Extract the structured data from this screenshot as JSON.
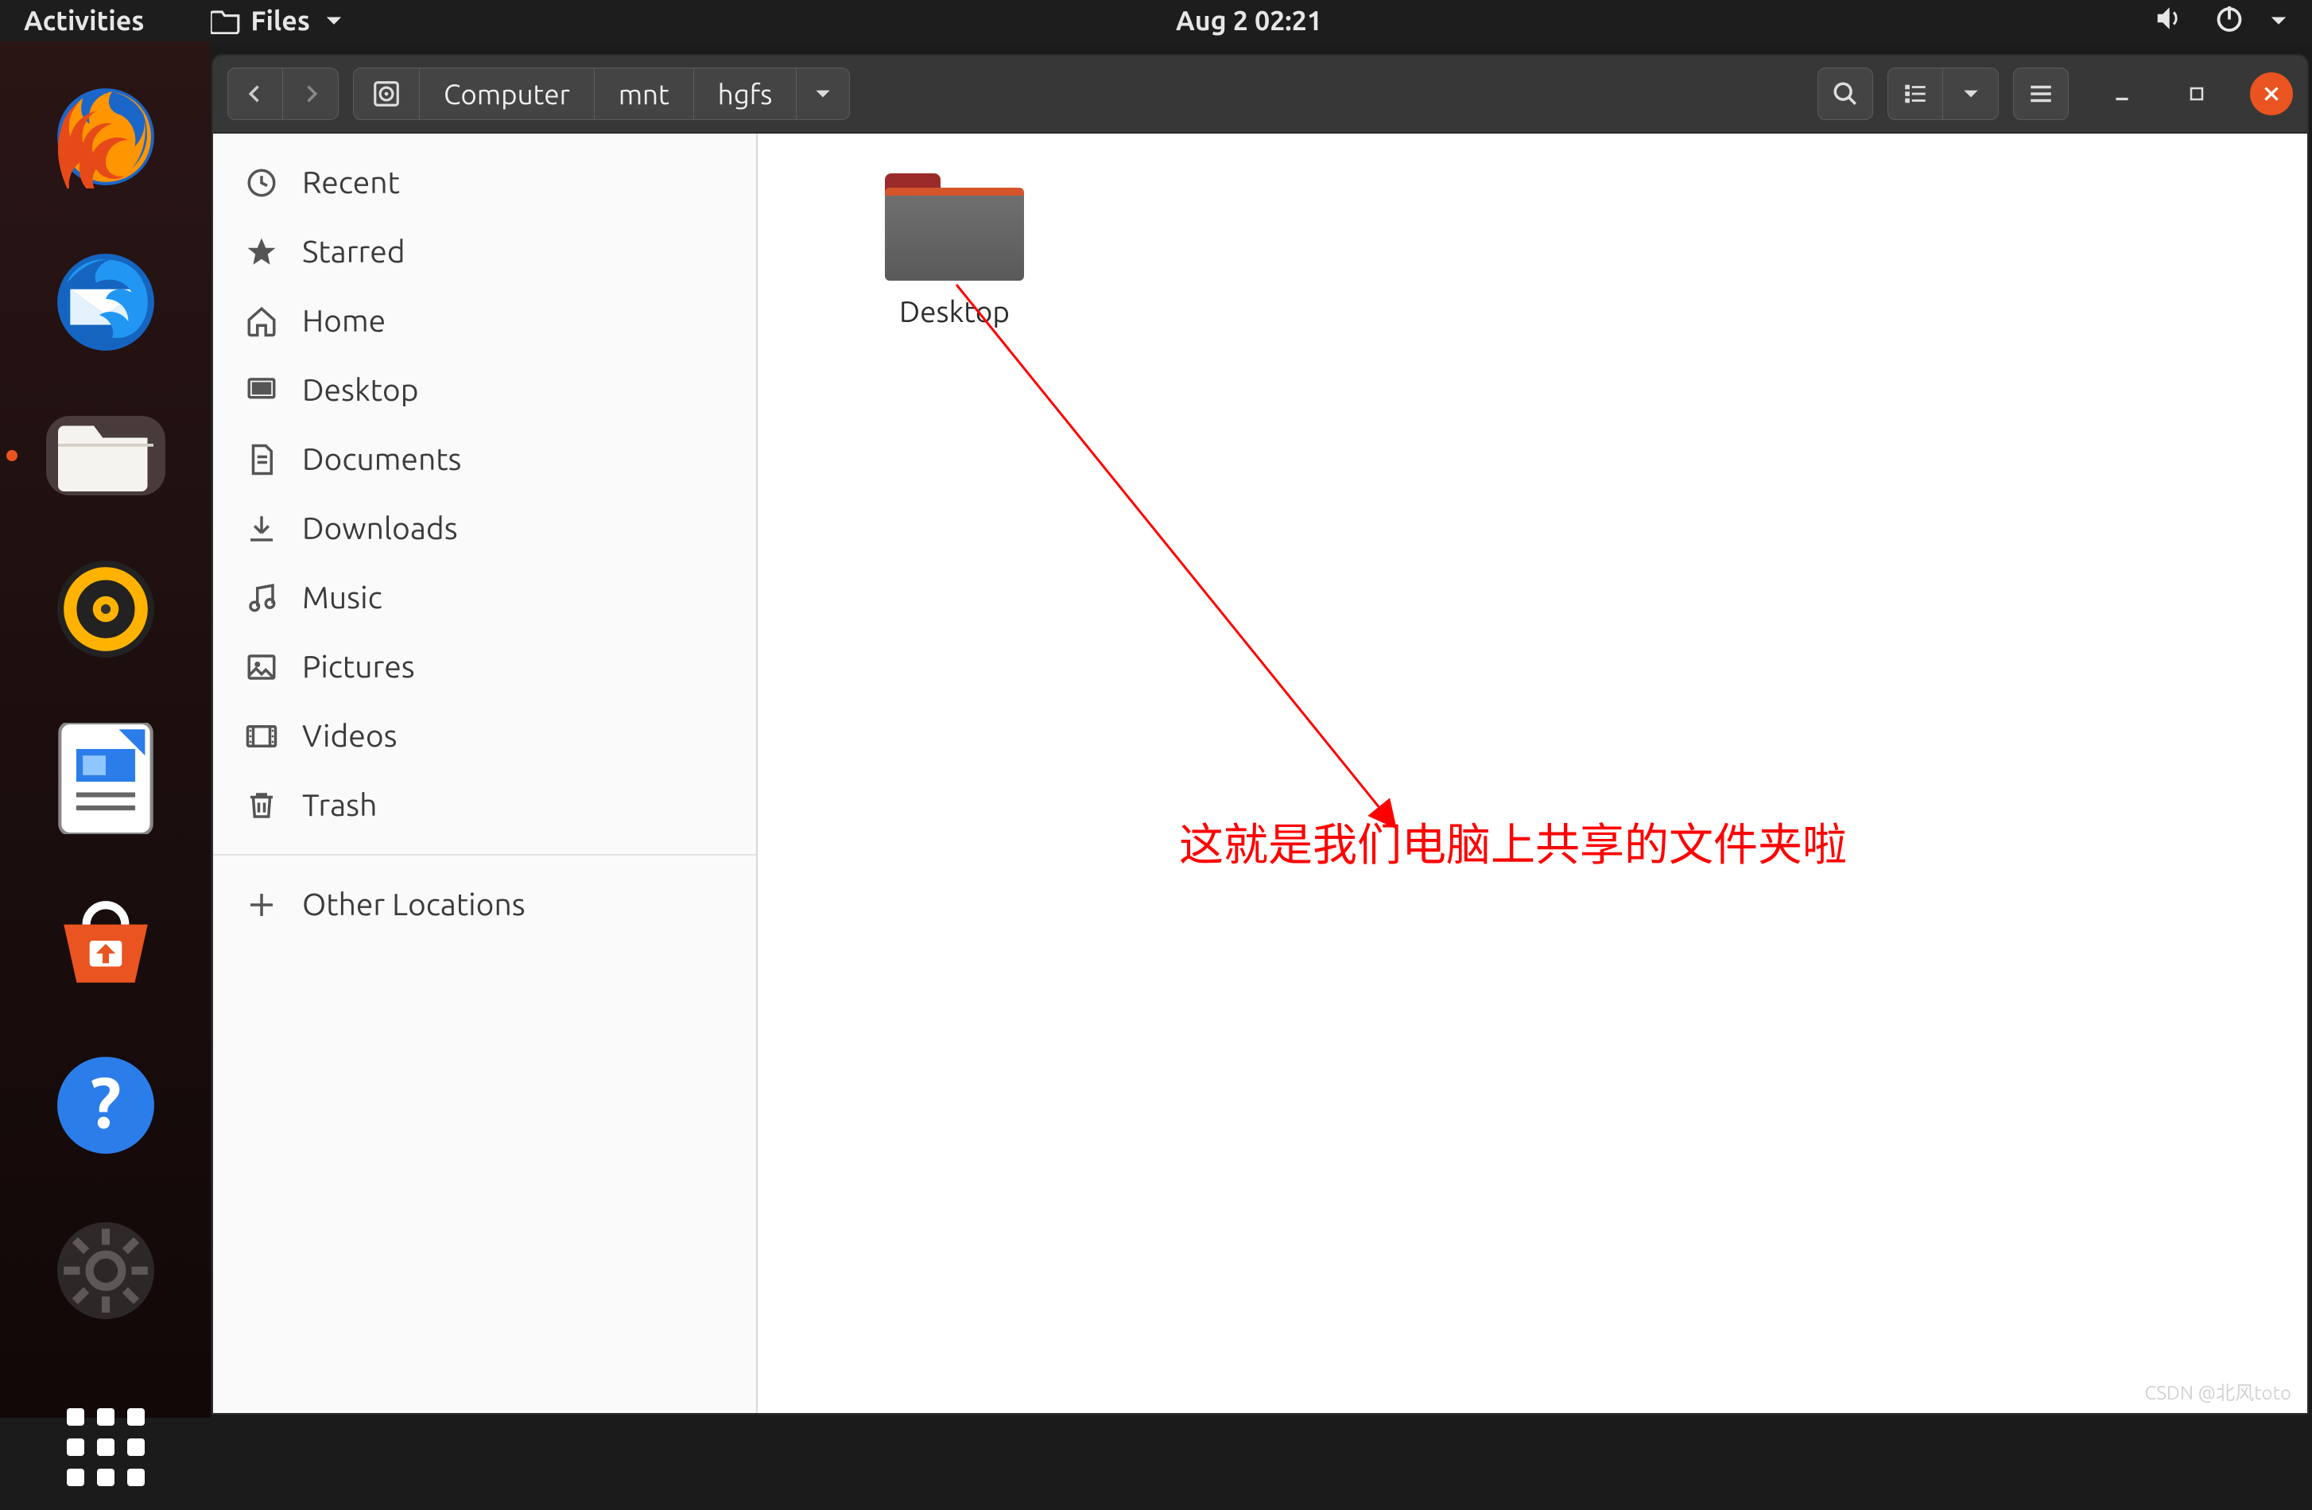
{
  "topbar": {
    "activities": "Activities",
    "app_name": "Files",
    "datetime": "Aug 2  02:21"
  },
  "dock": {
    "items": [
      {
        "name": "firefox"
      },
      {
        "name": "thunderbird"
      },
      {
        "name": "files",
        "active": true
      },
      {
        "name": "rhythmbox"
      },
      {
        "name": "libreoffice-writer"
      },
      {
        "name": "ubuntu-software"
      },
      {
        "name": "help"
      },
      {
        "name": "settings"
      }
    ]
  },
  "headerbar": {
    "breadcrumb": [
      "Computer",
      "mnt",
      "hgfs"
    ]
  },
  "sidebar": {
    "items": [
      {
        "icon": "recent",
        "label": "Recent"
      },
      {
        "icon": "starred",
        "label": "Starred"
      },
      {
        "icon": "home",
        "label": "Home"
      },
      {
        "icon": "desktop",
        "label": "Desktop"
      },
      {
        "icon": "documents",
        "label": "Documents"
      },
      {
        "icon": "downloads",
        "label": "Downloads"
      },
      {
        "icon": "music",
        "label": "Music"
      },
      {
        "icon": "pictures",
        "label": "Pictures"
      },
      {
        "icon": "videos",
        "label": "Videos"
      },
      {
        "icon": "trash",
        "label": "Trash"
      }
    ],
    "other_locations": "Other Locations"
  },
  "content": {
    "folders": [
      {
        "name": "Desktop"
      }
    ]
  },
  "annotation": {
    "text": "这就是我们电脑上共享的文件夹啦"
  },
  "watermark": "CSDN @北风toto"
}
